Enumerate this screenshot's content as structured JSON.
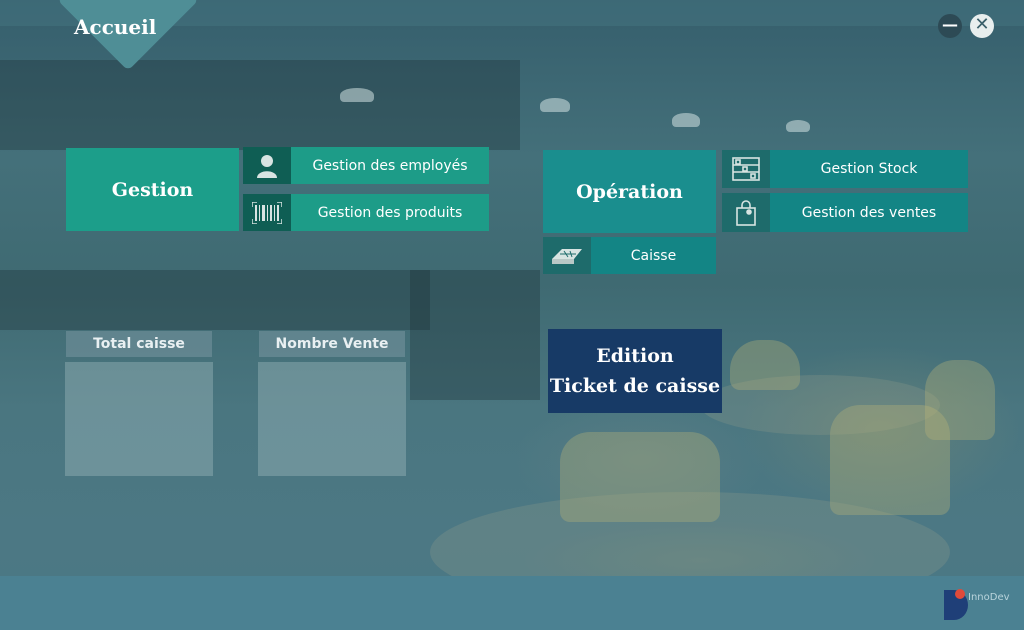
{
  "window": {
    "title": "Accueil",
    "minimize_symbol": "—",
    "close_symbol": "✕"
  },
  "gestion": {
    "title": "Gestion",
    "employees_label": "Gestion des employés",
    "products_label": "Gestion des produits"
  },
  "operation": {
    "title": "Opération",
    "stock_label": "Gestion Stock",
    "sales_label": "Gestion des ventes",
    "caisse_label": "Caisse"
  },
  "stats": {
    "total_caisse_label": "Total caisse",
    "nombre_vente_label": "Nombre Vente"
  },
  "ticket": {
    "line1": "Edition",
    "line2": "Ticket de caisse"
  },
  "footer": {
    "logo_text": "InnoDev"
  },
  "colors": {
    "accent_green": "#1c9e8a",
    "accent_teal": "#1a8e8e",
    "ticket_blue": "#173a66",
    "footer": "#4b8192"
  }
}
